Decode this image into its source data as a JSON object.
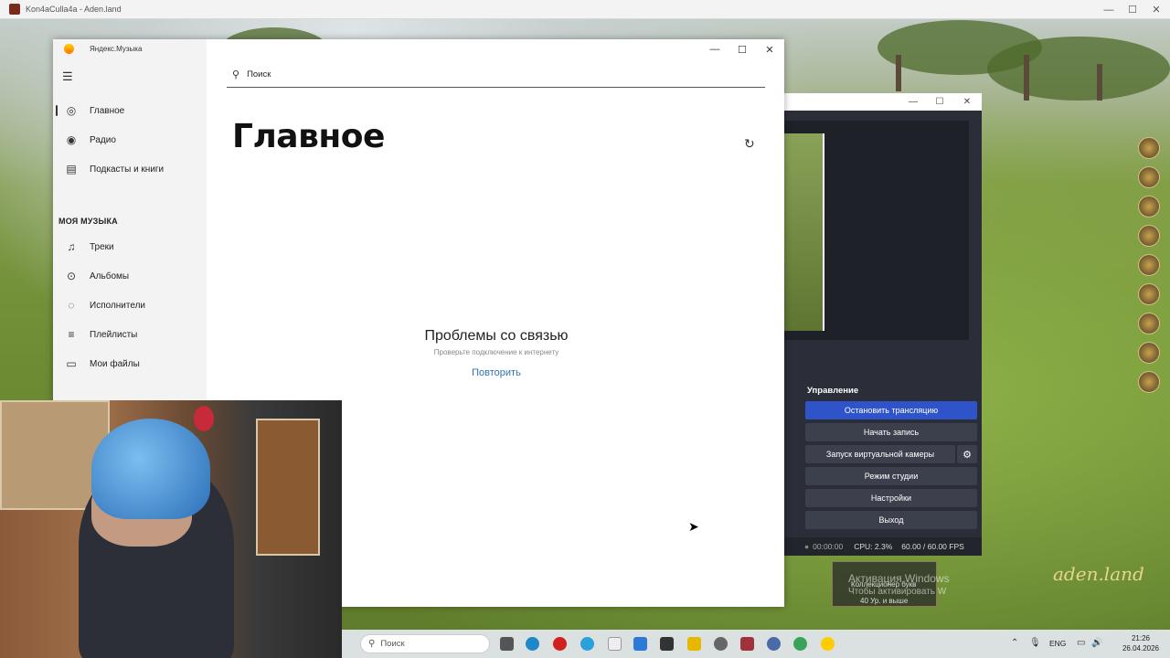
{
  "game_window": {
    "title": "Kon4aCulla4a - Aden.land",
    "activation_line1": "Активация Windows",
    "activation_line2": "Чтобы активировать W",
    "collector_line1": "Коллекционер букв",
    "collector_line2": "40 Ур. и выше",
    "brand": "aden.land"
  },
  "yandex_music": {
    "title": "Яндекс.Музыка",
    "search_placeholder": "Поиск",
    "nav": [
      {
        "label": "Главное",
        "icon": "target-icon"
      },
      {
        "label": "Радио",
        "icon": "radio-icon"
      },
      {
        "label": "Подкасты и книги",
        "icon": "book-icon"
      }
    ],
    "section_label": "МОЯ МУЗЫКА",
    "my_music": [
      {
        "label": "Треки",
        "icon": "note-icon"
      },
      {
        "label": "Альбомы",
        "icon": "disc-icon"
      },
      {
        "label": "Исполнители",
        "icon": "artist-icon"
      },
      {
        "label": "Плейлисты",
        "icon": "playlist-icon"
      },
      {
        "label": "Мои файлы",
        "icon": "folder-icon"
      }
    ],
    "page_title": "Главное",
    "error_title": "Проблемы со связью",
    "error_subtitle": "Проверьте подключение к интернету",
    "retry_label": "Повторить"
  },
  "obs": {
    "panel_title": "Управление",
    "buttons": [
      "Остановить трансляцию",
      "Начать запись",
      "Запуск виртуальной камеры",
      "Режим студии",
      "Настройки",
      "Выход"
    ],
    "status_time": "00:00:00",
    "status_cpu": "CPU: 2.3%",
    "status_fps": "60.00 / 60.00 FPS",
    "accent": "#2f54c9"
  },
  "taskbar": {
    "search_placeholder": "Поиск",
    "lang": "ENG",
    "time": "21:26",
    "date": "26.04.2026"
  }
}
